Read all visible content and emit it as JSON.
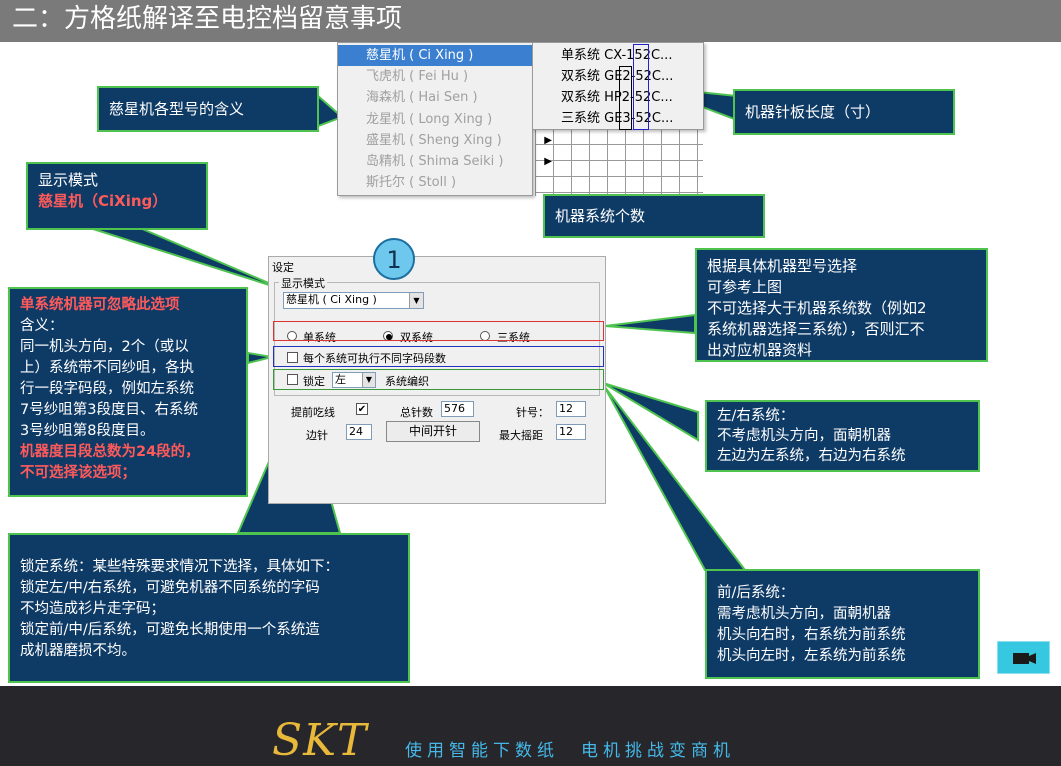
{
  "header": {
    "title": "二：方格纸解译至电控档留意事项"
  },
  "menu": {
    "items": [
      "慈星机 ( Ci Xing )",
      "飞虎机 ( Fei Hu )",
      "海森机 ( Hai Sen )",
      "龙星机 ( Long Xing )",
      "盛星机 ( Sheng Xing )",
      "岛精机 ( Shima Seiki )",
      "斯托尔 ( Stoll )"
    ],
    "submenu": [
      "单系统 CX-152C...",
      "双系统 GE2-52C...",
      "双系统 HP2-52C...",
      "三系统 GE3-52C..."
    ]
  },
  "callouts": {
    "model_meaning": "慈星机各型号的含义",
    "needle_length": "机器针板长度（寸）",
    "system_count": "机器系统个数",
    "display_mode_label": "显示模式",
    "display_mode_value": "慈星机（CiXing）",
    "select_by_model": [
      "根据具体机器型号选择",
      "可参考上图",
      "不可选择大于机器系统数（例如2",
      "系统机器选择三系统），否则汇不",
      "出对应机器资料"
    ],
    "single_system_title": "单系统机器可忽略此选项",
    "single_system_body": [
      "含义：",
      "同一机头方向，2个（或以",
      "上）系统带不同纱咀，各执",
      "行一段字码段，例如左系统",
      "7号纱咀第3段度目、右系统",
      "3号纱咀第8段度目。"
    ],
    "single_system_warn": [
      "机器度目段总数为24段的，",
      "不可选择该选项；"
    ],
    "left_right": [
      "左/右系统：",
      "不考虑机头方向，面朝机器",
      "左边为左系统，右边为右系统"
    ],
    "lock_system": [
      "锁定系统：某些特殊要求情况下选择，具体如下：",
      "锁定左/中/右系统，可避免机器不同系统的字码",
      "不均造成衫片走字码；",
      "锁定前/中/后系统，可避免长期使用一个系统造",
      "成机器磨损不均。"
    ],
    "front_back": [
      "前/后系统：",
      "需考虑机头方向，面朝机器",
      "机头向右时，右系统为前系统",
      "机头向左时，左系统为前系统"
    ]
  },
  "dialog": {
    "title": "设定",
    "group_label": "显示模式",
    "combo_value": "慈星机 ( Ci Xing )",
    "radio_single": "单系统",
    "radio_double": "双系统",
    "radio_triple": "三系统",
    "per_system_checkbox": "每个系统可执行不同字码段数",
    "lock_label": "锁定",
    "lock_value": "左",
    "system_weave_label": "系统编织",
    "early_label": "提前吃线",
    "total_needles_label": "总针数",
    "total_needles_value": "576",
    "gauge_label": "针号：",
    "gauge_value": "12",
    "side_needle_label": "边针",
    "side_needle_value": "24",
    "center_button": "中间开针",
    "max_rack_label": "最大摇距",
    "max_rack_value": "12"
  },
  "step_number": "1",
  "footer": {
    "logo": "SKT",
    "slogan": "使用智能下数纸　电机挑战变商机"
  },
  "colors": {
    "header_bg": "#7a7a7a",
    "callout_bg": "#0e3a66",
    "callout_border": "#4fc34f",
    "highlight_red": "#ff5a5a",
    "menu_selected": "#3a7fd0",
    "footer_bg": "#26262b",
    "logo": "#e8b83a",
    "slogan": "#45b8e8"
  },
  "icons": {
    "camera": "video-camera-icon",
    "arrow": "chevron-right-icon"
  }
}
